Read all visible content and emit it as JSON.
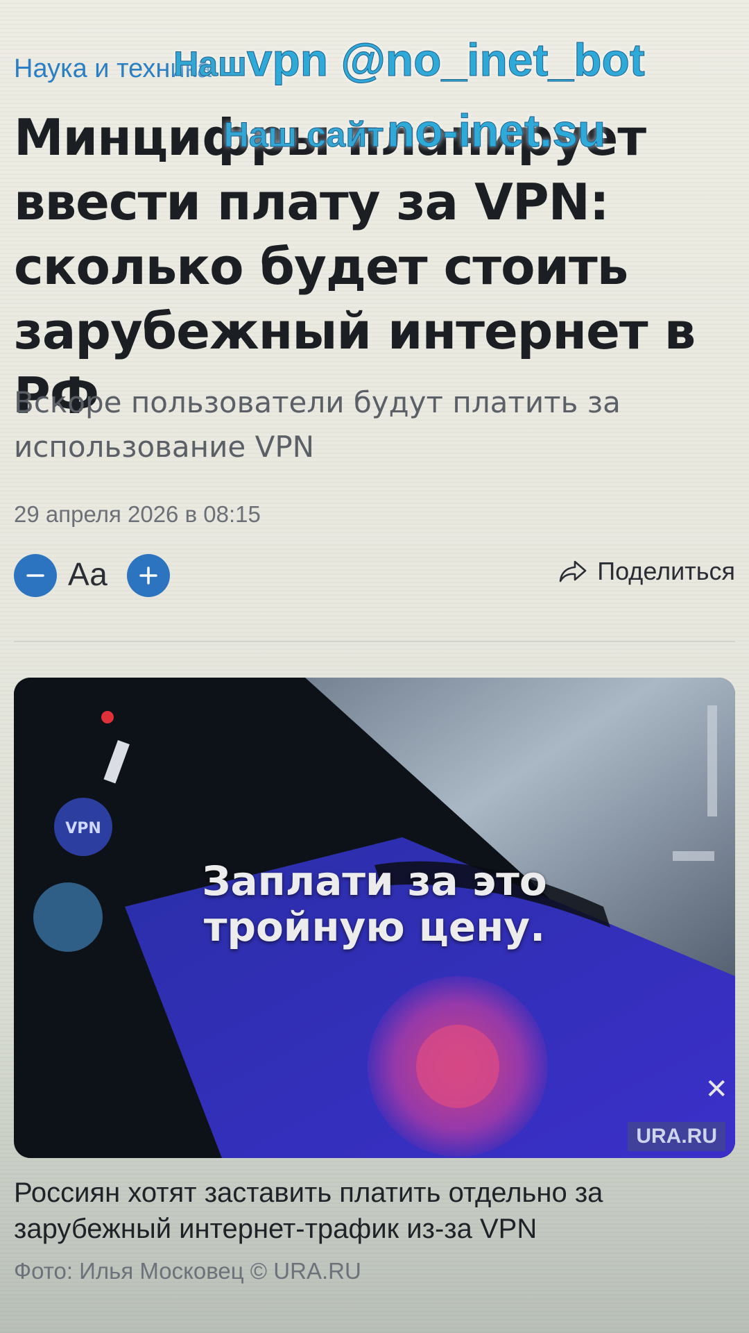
{
  "article": {
    "category": "Наука и техника",
    "headline": "Минцифры планирует ввести плату за VPN: сколько будет стоить зарубежный интернет в РФ",
    "lead": "Вскоре пользователи будут платить за использование VPN",
    "date": "29 апреля 2026 в 08:15"
  },
  "toolbar": {
    "decrease_icon": "minus-icon",
    "font_label": "Аа",
    "increase_icon": "plus-icon",
    "share_icon": "share-arrow-icon",
    "share_label": "Поделиться"
  },
  "photo": {
    "text_line1": "Заплати за это",
    "text_line2": "тройную цену.",
    "watermark": "URA.RU",
    "close_glyph": "✕",
    "phone_app_label": "VPN"
  },
  "caption": {
    "text": "Россиян хотят заставить платить отдельно за зарубежный интернет-трафик из-за VPN",
    "credit": "Фото: Илья Московец © URA.RU"
  },
  "overlay": {
    "line1_prefix": "Наш",
    "line1_main": "vpn @no_inet_bot",
    "line2_prefix": "Наш сайт",
    "line2_main": "no-inet.su"
  },
  "colors": {
    "accent": "#2d74c0",
    "overlay_text": "#2fa9d8",
    "background": "#ecebe2"
  }
}
